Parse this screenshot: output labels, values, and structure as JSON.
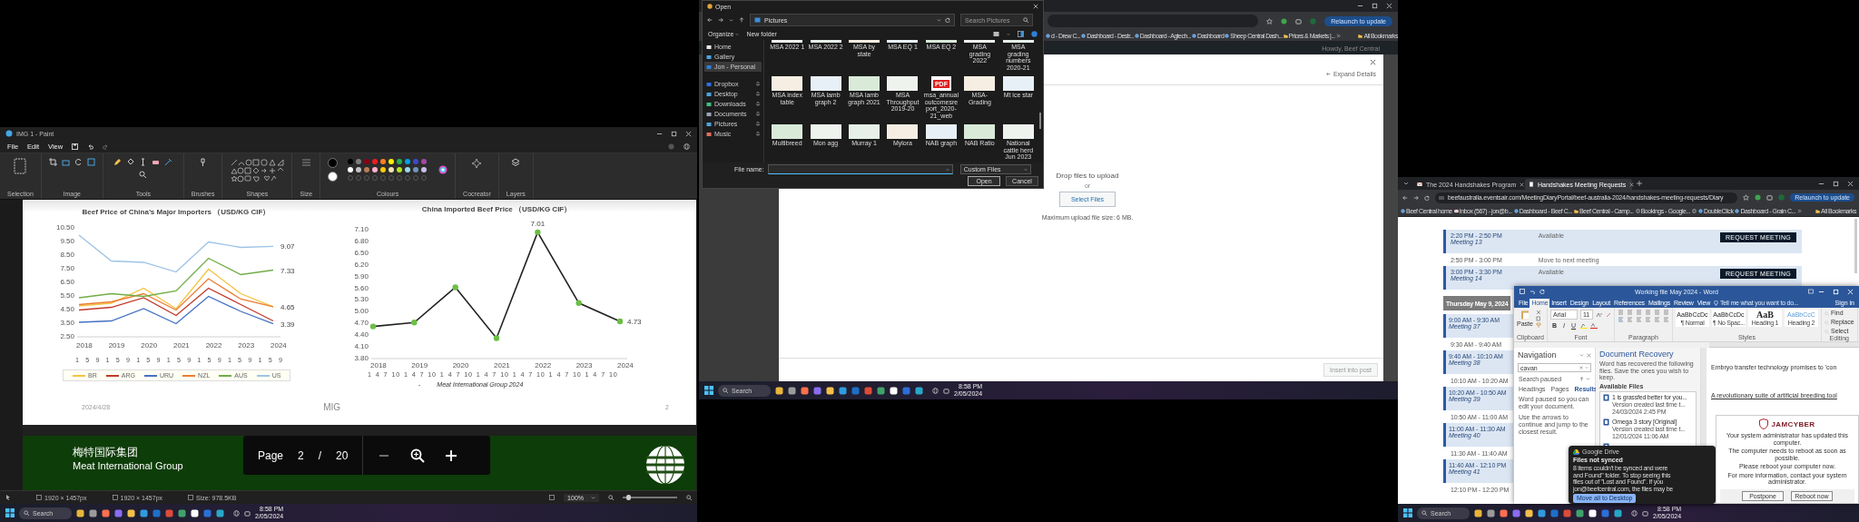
{
  "left_screen": {
    "paint": {
      "title": "IMG 1 - Paint",
      "menu": [
        "File",
        "Edit",
        "View"
      ],
      "ribbon_groups": [
        "Selection",
        "Image",
        "Tools",
        "Brushes",
        "Shapes",
        "Size",
        "Colours",
        "Cocreator",
        "Layers"
      ],
      "current_colors": [
        {
          "color": "#000000"
        },
        {
          "color": "#ffffff"
        }
      ],
      "palette": [
        {
          "color": "#000000"
        },
        {
          "color": "#7f7f7f"
        },
        {
          "color": "#880015"
        },
        {
          "color": "#ed1c24"
        },
        {
          "color": "#ff7f27"
        },
        {
          "color": "#fff200"
        },
        {
          "color": "#22b14c"
        },
        {
          "color": "#00a2e8"
        },
        {
          "color": "#3f48cc"
        },
        {
          "color": "#a349a4"
        },
        {
          "color": "#ffffff"
        },
        {
          "color": "#c3c3c3"
        },
        {
          "color": "#b97a57"
        },
        {
          "color": "#ffaec9"
        },
        {
          "color": "#ffc90e"
        },
        {
          "color": "#efe4b0"
        },
        {
          "color": "#b5e61d"
        },
        {
          "color": "#99d9ea"
        },
        {
          "color": "#7092be"
        },
        {
          "color": "#c8bfe7"
        }
      ],
      "slide": {
        "charts": [
          {
            "chart_data": {
              "type": "line",
              "title": "Beef Price of China’s Major Importers （USD/KG CIF）",
              "categories": [
                "2018",
                "2019",
                "2020",
                "2021",
                "2022",
                "2023",
                "2024"
              ],
              "series": [
                {
                  "name": "BR",
                  "color": "#f5c342",
                  "values": [
                    4.7,
                    4.9,
                    6.0,
                    4.5,
                    7.4,
                    5.6,
                    4.65
                  ]
                },
                {
                  "name": "ARG",
                  "color": "#c0392b",
                  "values": [
                    4.4,
                    4.6,
                    5.3,
                    4.0,
                    6.0,
                    4.8,
                    3.6
                  ]
                },
                {
                  "name": "URU",
                  "color": "#4472c4",
                  "values": [
                    3.5,
                    3.6,
                    4.5,
                    3.4,
                    5.4,
                    4.3,
                    3.39
                  ]
                },
                {
                  "name": "NZL",
                  "color": "#ed7d31",
                  "values": [
                    4.8,
                    5.0,
                    5.6,
                    4.4,
                    6.7,
                    5.2,
                    4.65
                  ]
                },
                {
                  "name": "AUS",
                  "color": "#70ad47",
                  "values": [
                    5.3,
                    5.6,
                    5.4,
                    5.8,
                    8.2,
                    7.0,
                    7.33
                  ]
                },
                {
                  "name": "US",
                  "color": "#9dc3e6",
                  "values": [
                    9.9,
                    8.0,
                    7.9,
                    7.2,
                    9.4,
                    9.0,
                    9.07
                  ]
                }
              ],
              "ylim": [
                2.5,
                10.5
              ],
              "yticks": [
                {
                  "value": 2.5,
                  "label": "2.50"
                },
                {
                  "value": 3.5,
                  "label": "3.50"
                },
                {
                  "value": 4.5,
                  "label": "4.50"
                },
                {
                  "value": 5.5,
                  "label": "5.50"
                },
                {
                  "value": 6.5,
                  "label": "6.50"
                },
                {
                  "value": 7.5,
                  "label": "7.50"
                },
                {
                  "value": 8.5,
                  "label": "8.50"
                },
                {
                  "value": 9.5,
                  "label": "9.50"
                },
                {
                  "value": 10.5,
                  "label": "10.50"
                }
              ],
              "legend": "bottom",
              "annotations": [
                "9.07",
                "7.33",
                "4.65",
                "3.39"
              ]
            },
            "month_labels": "1 5 9 1 5 9 1 5 9 1 5 9 1 5 9 1 5 9 1 5 9"
          },
          {
            "chart_data": {
              "type": "line",
              "title": "China Imported Beef Price （USD/KG CIF）",
              "categories": [
                "2018",
                "2019",
                "2020",
                "2021",
                "2022",
                "2023",
                "2024"
              ],
              "series": [
                {
                  "color": "#6abf45",
                  "marker": "circle",
                  "values": [
                    4.6,
                    4.7,
                    5.6,
                    4.3,
                    7.01,
                    5.2,
                    4.73
                  ]
                }
              ],
              "ylim": [
                3.8,
                7.1
              ],
              "yticks": [
                {
                  "value": 3.8,
                  "label": "3.80"
                },
                {
                  "value": 4.1,
                  "label": "4.10"
                },
                {
                  "value": 4.4,
                  "label": "4.40"
                },
                {
                  "value": 4.7,
                  "label": "4.70"
                },
                {
                  "value": 5.0,
                  "label": "5.00"
                },
                {
                  "value": 5.3,
                  "label": "5.30"
                },
                {
                  "value": 5.6,
                  "label": "5.60"
                },
                {
                  "value": 5.9,
                  "label": "5.90"
                },
                {
                  "value": 6.2,
                  "label": "6.20"
                },
                {
                  "value": 6.5,
                  "label": "6.50"
                },
                {
                  "value": 6.8,
                  "label": "6.80"
                },
                {
                  "value": 7.1,
                  "label": "7.10"
                }
              ],
              "annotations": [
                {
                  "text": "7.01",
                  "x": "2022",
                  "y": 7.01
                },
                {
                  "text": "4.73",
                  "x": "2024",
                  "y": 4.73
                }
              ]
            },
            "month_labels": "1 4 7 10 1 4 7 10 1 4 7 10 1 4 7 10 1 4 7 10 1 4 7 10 1 4 7 10"
          }
        ],
        "source_dash": "-",
        "source": "Meat International Group 2024",
        "date": "2024/4/28",
        "footer_org": "MIG",
        "page_number": "2"
      },
      "next_slide": {
        "name_cn": "梅特国际集团",
        "name_en": "Meat International Group"
      },
      "page_toolbar": {
        "label": "Page",
        "page": "2",
        "separator": "/",
        "total": "20"
      },
      "status": [
        "1920 × 1457px",
        "1920 × 1457px",
        "Size: 978.5KB"
      ],
      "zoom": "100%",
      "zoom_slider": {
        "level": 0.1
      }
    },
    "taskbar": {
      "search": "Search",
      "time": "8:58 PM",
      "date": "2/05/2024"
    }
  },
  "middle_screen": {
    "browser": {
      "relaunch": "Relaunch to update",
      "bookmarks": [
        "d - Drew C...",
        "Dashboard - Destr...",
        "Dashboard - Agtech...",
        "Dashboard",
        "Sheep Central Dash...",
        "Prices & Markets |...",
        "All Bookmarks"
      ],
      "account": "Howdy, Beef Central",
      "modal": {
        "expand": "Expand Details",
        "drop": "Drop files to upload",
        "or": "or",
        "select": "Select Files",
        "max": "Maximum upload file size: 6 MB.",
        "insert": "Insert into post"
      }
    },
    "open_dialog": {
      "title": "Open",
      "path": "Pictures",
      "search_placeholder": "Search Pictures",
      "commands": [
        "Organize",
        "New folder"
      ],
      "nav": [
        {
          "label": "Home",
          "selected": false
        },
        {
          "label": "Gallery",
          "selected": false
        },
        {
          "label": "Jon - Personal",
          "selected": true
        },
        {
          "label": "Dropbox",
          "selected": false
        },
        {
          "label": "Desktop",
          "selected": false
        },
        {
          "label": "Downloads",
          "selected": false
        },
        {
          "label": "Documents",
          "selected": false
        },
        {
          "label": "Pictures",
          "selected": false
        },
        {
          "label": "Music",
          "selected": false
        }
      ],
      "files": [
        {
          "name": "MSA 2022 1",
          "kind": "image"
        },
        {
          "name": "MSA 2022 2",
          "kind": "image"
        },
        {
          "name": "MSA by state",
          "kind": "image"
        },
        {
          "name": "MSA EQ 1",
          "kind": "image"
        },
        {
          "name": "MSA EQ 2",
          "kind": "image"
        },
        {
          "name": "MSA grading 2022",
          "kind": "image"
        },
        {
          "name": "MSA grading numbers 2020-21",
          "kind": "image"
        },
        {
          "name": "MSA index table",
          "kind": "image"
        },
        {
          "name": "MSA lamb graph 2",
          "kind": "image"
        },
        {
          "name": "MSA lamb graph 2021",
          "kind": "image"
        },
        {
          "name": "MSA Throughput 2019-20",
          "kind": "image"
        },
        {
          "name": "msa_annualoutcomesreport_2020-21_web",
          "kind": "pdf",
          "badge": "PDF"
        },
        {
          "name": "MSA-Grading",
          "kind": "image"
        },
        {
          "name": "Mt ice star",
          "kind": "image"
        },
        {
          "name": "Multibreed",
          "kind": "image"
        },
        {
          "name": "Mon agg",
          "kind": "image"
        },
        {
          "name": "Murray 1",
          "kind": "image"
        },
        {
          "name": "Mylora",
          "kind": "image"
        },
        {
          "name": "NAB graph",
          "kind": "image"
        },
        {
          "name": "NAB Ratio",
          "kind": "image"
        },
        {
          "name": "National cattle herd Jun 2023",
          "kind": "image"
        }
      ],
      "file_name_label": "File name:",
      "filter": "Custom Files",
      "buttons": [
        "Open",
        "Cancel"
      ]
    },
    "taskbar": {
      "search": "Search",
      "time": "8:58 PM",
      "date": "2/05/2024"
    }
  },
  "right_screen": {
    "browser": {
      "tabs": [
        {
          "label": "The 2024 Handshakes Program",
          "selected": false
        },
        {
          "label": "Handshakes Meeting Requests",
          "selected": true
        }
      ],
      "url": "beefaustralia.eventsair.com/MeetingDiaryPortal/beef-australia-2024/handshakes-meeting-requests/Diary",
      "relaunch": "Relaunch to update",
      "bookmarks": [
        "Beef Central home",
        "Inbox (567) - jon@b...",
        "Dashboard - Beef C...",
        "Beef Central - Camp...",
        "Bookings - Google...",
        "DoubleClick",
        "Dashboard - Grain C...",
        "All Bookmarks"
      ]
    },
    "diary": [
      {
        "kind": "meeting",
        "time": "2:20 PM - 2:50 PM",
        "label": "Meeting 13",
        "status": "Available",
        "button": "REQUEST MEETING"
      },
      {
        "kind": "gap",
        "time": "2:50 PM - 3:00 PM",
        "note": "Move to next meeting"
      },
      {
        "kind": "meeting",
        "time": "3:00 PM - 3:30 PM",
        "label": "Meeting 14",
        "status": "Available",
        "button": "REQUEST MEETING"
      },
      {
        "kind": "day",
        "label": "Thursday May 9, 2024"
      },
      {
        "kind": "meeting",
        "time": "9:00 AM - 9:30 AM",
        "label": "Meeting 37"
      },
      {
        "kind": "gap",
        "time": "9:30 AM - 9:40 AM"
      },
      {
        "kind": "meeting",
        "time": "9:40 AM - 10:10 AM",
        "label": "Meeting 38"
      },
      {
        "kind": "gap",
        "time": "10:10 AM - 10:20 AM"
      },
      {
        "kind": "meeting",
        "time": "10:20 AM - 10:50 AM",
        "label": "Meeting 39"
      },
      {
        "kind": "gap",
        "time": "10:50 AM - 11:00 AM"
      },
      {
        "kind": "meeting",
        "time": "11:00 AM - 11:30 AM",
        "label": "Meeting 40"
      },
      {
        "kind": "gap",
        "time": "11:30 AM - 11:40 AM"
      },
      {
        "kind": "meeting",
        "time": "11:40 AM - 12:10 PM",
        "label": "Meeting 41"
      },
      {
        "kind": "gap",
        "time": "12:10 PM - 12:20 PM"
      }
    ],
    "word": {
      "title": "Working file May 2024 - Word",
      "tabs": [
        {
          "label": "File",
          "selected": false
        },
        {
          "label": "Home",
          "selected": true
        },
        {
          "label": "Insert",
          "selected": false
        },
        {
          "label": "Design",
          "selected": false
        },
        {
          "label": "Layout",
          "selected": false
        },
        {
          "label": "References",
          "selected": false
        },
        {
          "label": "Mailings",
          "selected": false
        },
        {
          "label": "Review",
          "selected": false
        },
        {
          "label": "View",
          "selected": false
        }
      ],
      "tell": "Tell me what you want to do...",
      "signin": "Sign in",
      "paste": "Paste",
      "font": "Arial",
      "size": "11",
      "font_buttons": [
        "B",
        "I",
        "U"
      ],
      "styles": [
        {
          "sample": "AaBbCcDc",
          "name": "¶ Normal"
        },
        {
          "sample": "AaBbCcDc",
          "name": "¶ No Spac..."
        },
        {
          "sample": "AaB",
          "name": "Heading 1"
        },
        {
          "sample": "AaBbCcC",
          "name": "Heading 2"
        }
      ],
      "editing": [
        "Find",
        "Replace",
        "Select"
      ],
      "group_labels": [
        "Clipboard",
        "Font",
        "Paragraph",
        "Styles",
        "Editing"
      ],
      "navigation": {
        "title": "Navigation",
        "search": "cavan",
        "status": "Search paused",
        "tabs": [
          {
            "label": "Headings",
            "selected": false
          },
          {
            "label": "Pages",
            "selected": false
          },
          {
            "label": "Results",
            "selected": true
          }
        ],
        "messages": [
          "Word paused so you can edit your document.",
          "Use the arrows to continue and jump to the closest result."
        ]
      },
      "recovery": {
        "title": "Document Recovery",
        "intro": "Word has recovered the following files. Save the ones you wish to keep.",
        "list_label": "Available Files",
        "files": [
          {
            "name": "1 is grassfed better for you...",
            "detail": "Version created last time t...",
            "date": "24/03/2024 2:45 PM"
          },
          {
            "name": "Omega 3 story [Original]",
            "detail": "Version created last time t...",
            "date": "12/01/2024 11:06 AM"
          }
        ]
      },
      "document": [
        "Embryo transfer technology promises to 'con",
        "A revolutionary suite of artificial breeding tool"
      ]
    },
    "drive_popup": {
      "app": "Google Drive",
      "title": "Files not synced",
      "lines": [
        "8 items couldn't be synced and were",
        "and Found\" folder. To stop seeing this",
        "files out of \"Lost and Found\". If you",
        "jon@beefcentral.com, the files may be"
      ],
      "button": "Move all to Desktop"
    },
    "reboot_dialog": {
      "brand": "JAMCYBER",
      "lines": [
        "Your system administrator has updated this computer.",
        "The computer needs to reboot as soon as possible.",
        "Please reboot your computer now.",
        "For more information, contact your system administrator."
      ],
      "buttons": [
        "Postpone",
        "Reboot now"
      ]
    },
    "taskbar": {
      "search": "Search",
      "time": "8:58 PM",
      "date": "2/05/2024"
    }
  }
}
